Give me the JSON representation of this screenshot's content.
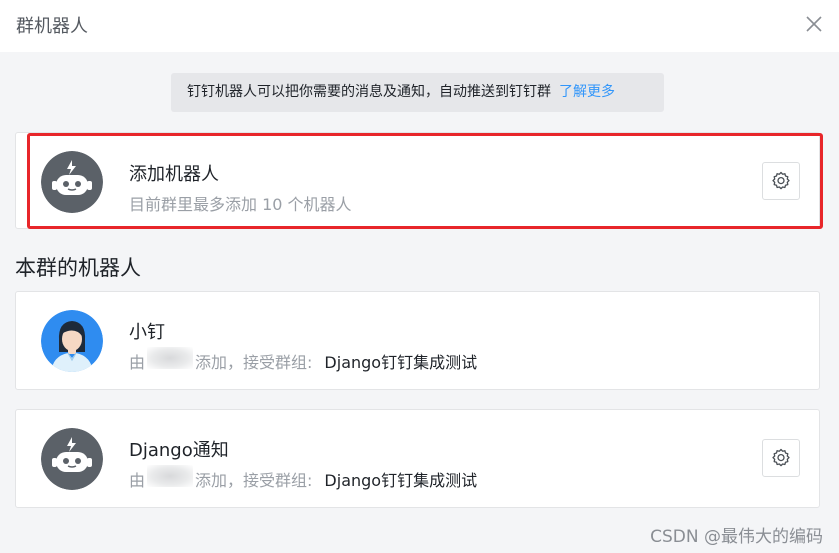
{
  "header": {
    "title": "群机器人",
    "close_icon": "close-icon"
  },
  "notice": {
    "text": "钉钉机器人可以把你需要的消息及通知，自动推送到钉钉群",
    "link": "了解更多"
  },
  "add_robot": {
    "name": "添加机器人",
    "subtitle": "目前群里最多添加 10 个机器人",
    "icon": "robot-icon",
    "settings_icon": "gear-icon"
  },
  "section_title": "本群的机器人",
  "robots": [
    {
      "name": "小钉",
      "prefix": "由",
      "added_text": "添加，接受群组:",
      "group": "Django钉钉集成测试",
      "avatar": "xiaoding-avatar"
    },
    {
      "name": "Django通知",
      "prefix": "由",
      "added_text": "添加，接受群组:",
      "group": "Django钉钉集成测试",
      "avatar": "robot-icon",
      "settings_icon": "gear-icon"
    }
  ],
  "watermark": "CSDN @最伟大的编码",
  "colors": {
    "link": "#3296fa",
    "highlight": "#e8262a",
    "robot_avatar": "#5b6168"
  }
}
